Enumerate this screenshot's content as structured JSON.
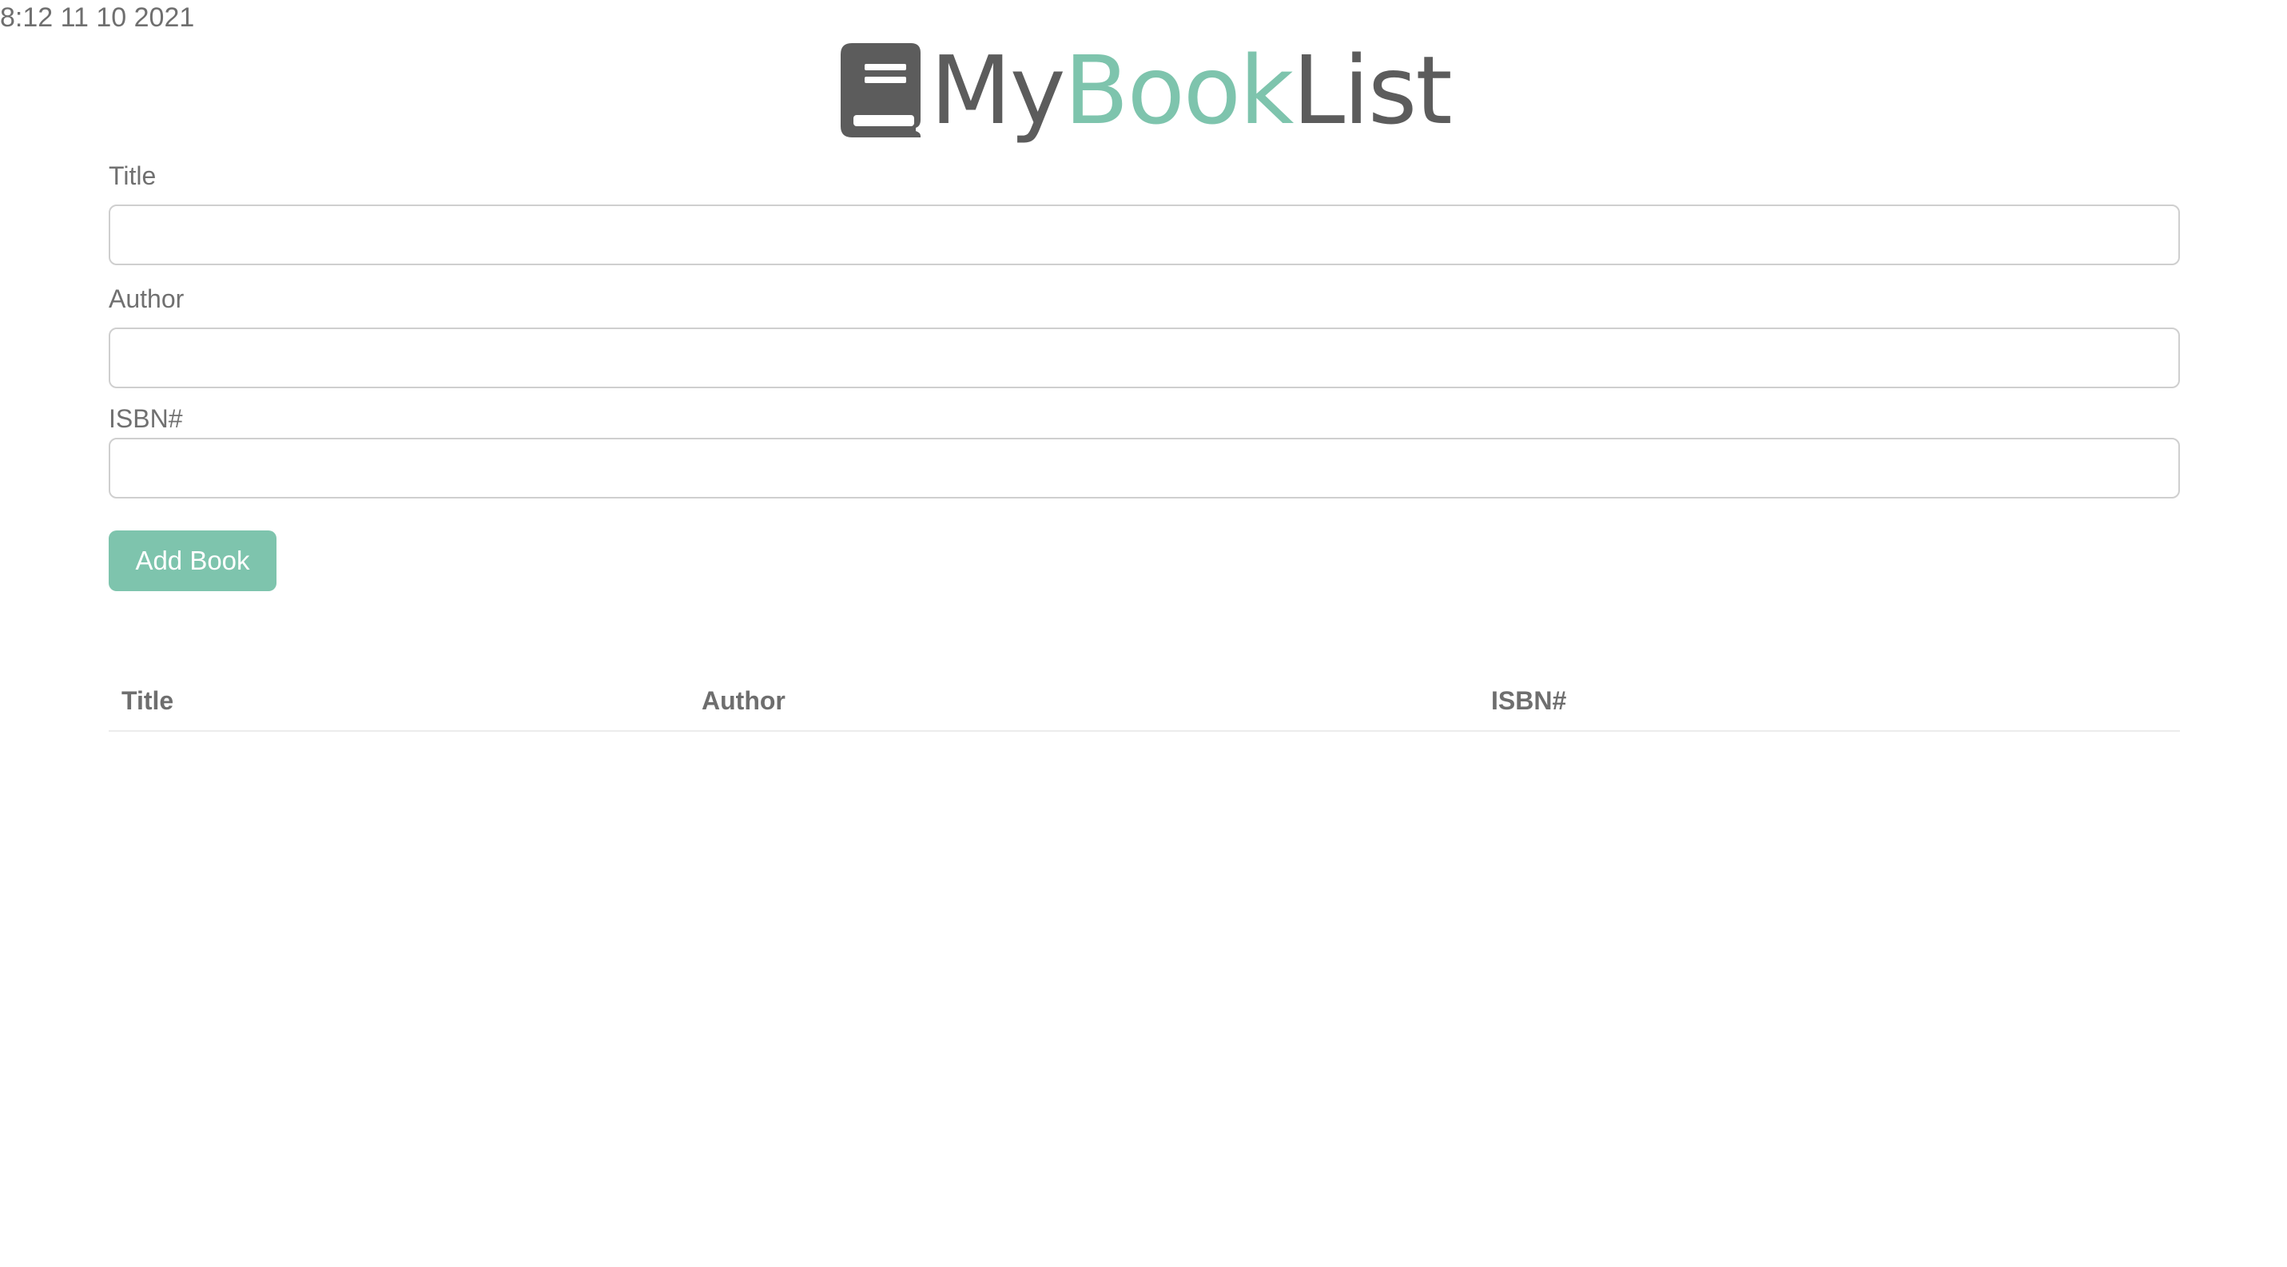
{
  "status": {
    "datetime": "8:12 11 10 2021"
  },
  "header": {
    "logo_icon": "book-icon",
    "title_part1": "My",
    "title_part2": "Book",
    "title_part3": "List",
    "colors": {
      "dark": "#5c5c5c",
      "accent": "#7ec4ad"
    }
  },
  "form": {
    "title_label": "Title",
    "title_value": "",
    "author_label": "Author",
    "author_value": "",
    "isbn_label": "ISBN#",
    "isbn_value": "",
    "submit_label": "Add Book"
  },
  "table": {
    "columns": [
      "Title",
      "Author",
      "ISBN#"
    ],
    "rows": []
  }
}
